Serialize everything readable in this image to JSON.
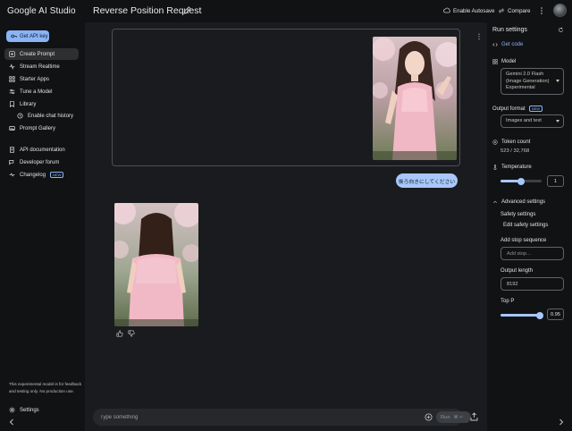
{
  "app": {
    "brand": "Google AI Studio",
    "doc_title": "Reverse Position Request",
    "enable_autosave": "Enable Autosave",
    "compare": "Compare"
  },
  "sidebar": {
    "get_api_key": "Get API key",
    "items": [
      {
        "label": "Create Prompt",
        "icon": "add-box-icon"
      },
      {
        "label": "Stream Realtime",
        "icon": "stream-icon"
      },
      {
        "label": "Starter Apps",
        "icon": "apps-icon"
      },
      {
        "label": "Tune a Model",
        "icon": "tune-icon"
      },
      {
        "label": "Library",
        "icon": "library-icon"
      },
      {
        "label": "Enable chat history",
        "icon": "history-icon"
      },
      {
        "label": "Prompt Gallery",
        "icon": "gallery-icon"
      },
      {
        "label": "API documentation",
        "icon": "docs-icon"
      },
      {
        "label": "Developer forum",
        "icon": "forum-icon"
      },
      {
        "label": "Changelog",
        "icon": "changelog-icon",
        "badge": "NEW"
      }
    ],
    "note": "This experimental model is for feedback and testing only. No production use.",
    "settings": "Settings"
  },
  "chat": {
    "user_message": "後ろ向きにしてください",
    "input_placeholder": "Type something",
    "run_label": "Run",
    "run_shortcut": "⌘ ↵"
  },
  "settings_panel": {
    "title": "Run settings",
    "get_code": "Get code",
    "model_label": "Model",
    "model_value": "Gemini 2.0 Flash (Image Generation) Experimental",
    "output_format_label": "Output format",
    "output_format_badge": "NEW",
    "output_format_value": "Images and text",
    "token_count_label": "Token count",
    "token_count_value": "523 / 32,768",
    "temperature_label": "Temperature",
    "temperature_value": "1",
    "temperature_fraction": 0.5,
    "advanced_settings": "Advanced settings",
    "safety_settings": "Safety settings",
    "edit_safety": "Edit safety settings",
    "stop_seq_label": "Add stop sequence",
    "stop_seq_placeholder": "Add stop...",
    "output_length_label": "Output length",
    "output_length_value": "8192",
    "top_p_label": "Top P",
    "top_p_value": "0.95",
    "top_p_fraction": 0.95
  },
  "colors": {
    "accent": "#8ab4f8",
    "bubble": "#a8c7fa",
    "main_bg": "#1a1b1e",
    "sidebar_bg": "#111214"
  }
}
